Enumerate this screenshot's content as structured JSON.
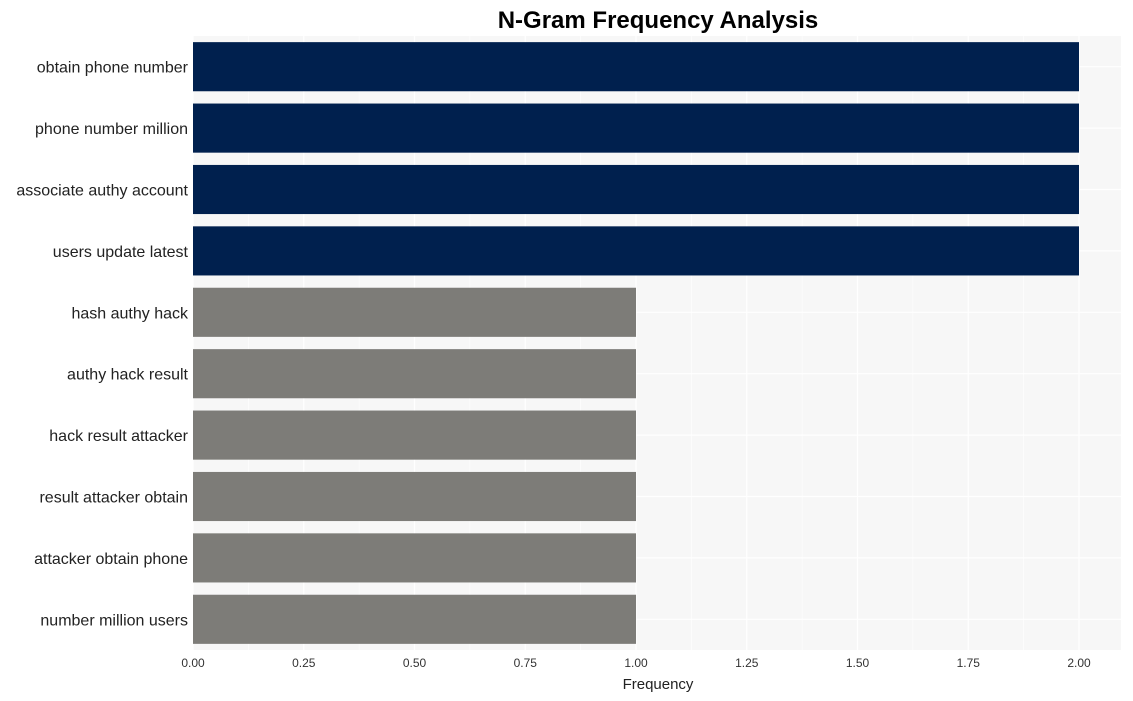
{
  "chart_data": {
    "type": "bar",
    "orientation": "horizontal",
    "title": "N-Gram Frequency Analysis",
    "xlabel": "Frequency",
    "ylabel": "",
    "xlim": [
      0,
      2.1
    ],
    "xticks": [
      0,
      0.25,
      0.5,
      0.75,
      1.0,
      1.25,
      1.5,
      1.75,
      2.0
    ],
    "xtick_labels": [
      "0.00",
      "0.25",
      "0.50",
      "0.75",
      "1.00",
      "1.25",
      "1.50",
      "1.75",
      "2.00"
    ],
    "grid": true,
    "categories": [
      "obtain phone number",
      "phone number million",
      "associate authy account",
      "users update latest",
      "hash authy hack",
      "authy hack result",
      "hack result attacker",
      "result attacker obtain",
      "attacker obtain phone",
      "number million users"
    ],
    "values": [
      2,
      2,
      2,
      2,
      1,
      1,
      1,
      1,
      1,
      1
    ],
    "colors": {
      "high": "#00204e",
      "low": "#7d7c78",
      "panel": "#f7f7f7",
      "grid": "#ffffff"
    }
  }
}
